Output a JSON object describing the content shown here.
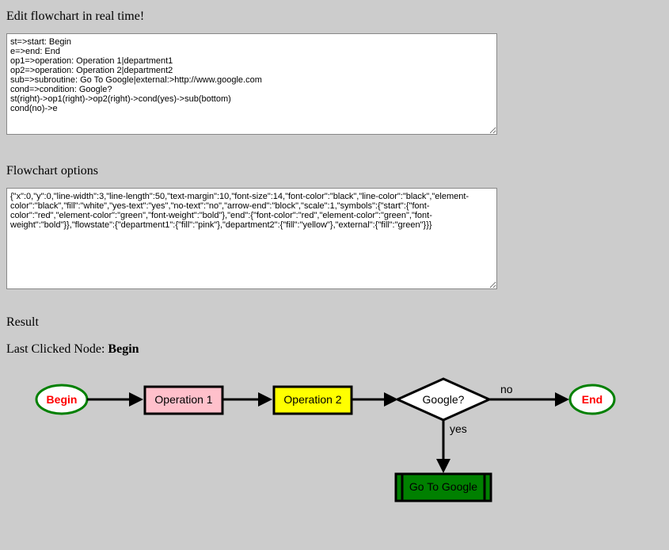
{
  "headings": {
    "edit": "Edit flowchart in real time!",
    "options": "Flowchart options",
    "result": "Result"
  },
  "code_text": "st=>start: Begin\ne=>end: End\nop1=>operation: Operation 1|department1\nop2=>operation: Operation 2|department2\nsub=>subroutine: Go To Google|external:>http://www.google.com\ncond=>condition: Google?\nst(right)->op1(right)->op2(right)->cond(yes)->sub(bottom)\ncond(no)->e",
  "options_text": "{\"x\":0,\"y\":0,\"line-width\":3,\"line-length\":50,\"text-margin\":10,\"font-size\":14,\"font-color\":\"black\",\"line-color\":\"black\",\"element-color\":\"black\",\"fill\":\"white\",\"yes-text\":\"yes\",\"no-text\":\"no\",\"arrow-end\":\"block\",\"scale\":1,\"symbols\":{\"start\":{\"font-color\":\"red\",\"element-color\":\"green\",\"font-weight\":\"bold\"},\"end\":{\"font-color\":\"red\",\"element-color\":\"green\",\"font-weight\":\"bold\"}},\"flowstate\":{\"department1\":{\"fill\":\"pink\"},\"department2\":{\"fill\":\"yellow\"},\"external\":{\"fill\":\"green\"}}}",
  "last_clicked": {
    "label": "Last Clicked Node: ",
    "value": "Begin"
  },
  "nodes": {
    "start_label": "Begin",
    "op1_label": "Operation 1",
    "op2_label": "Operation 2",
    "cond_label": "Google?",
    "end_label": "End",
    "sub_label": "Go To Google",
    "yes_text": "yes",
    "no_text": "no"
  },
  "colors": {
    "start_stroke": "#008000",
    "start_fill": "#ffffff",
    "start_font": "#ff0000",
    "end_stroke": "#008000",
    "end_fill": "#ffffff",
    "end_font": "#ff0000",
    "op1_fill": "#ffc0cb",
    "op2_fill": "#ffff00",
    "cond_fill": "#ffffff",
    "sub_fill": "#008000",
    "line": "#000000"
  }
}
